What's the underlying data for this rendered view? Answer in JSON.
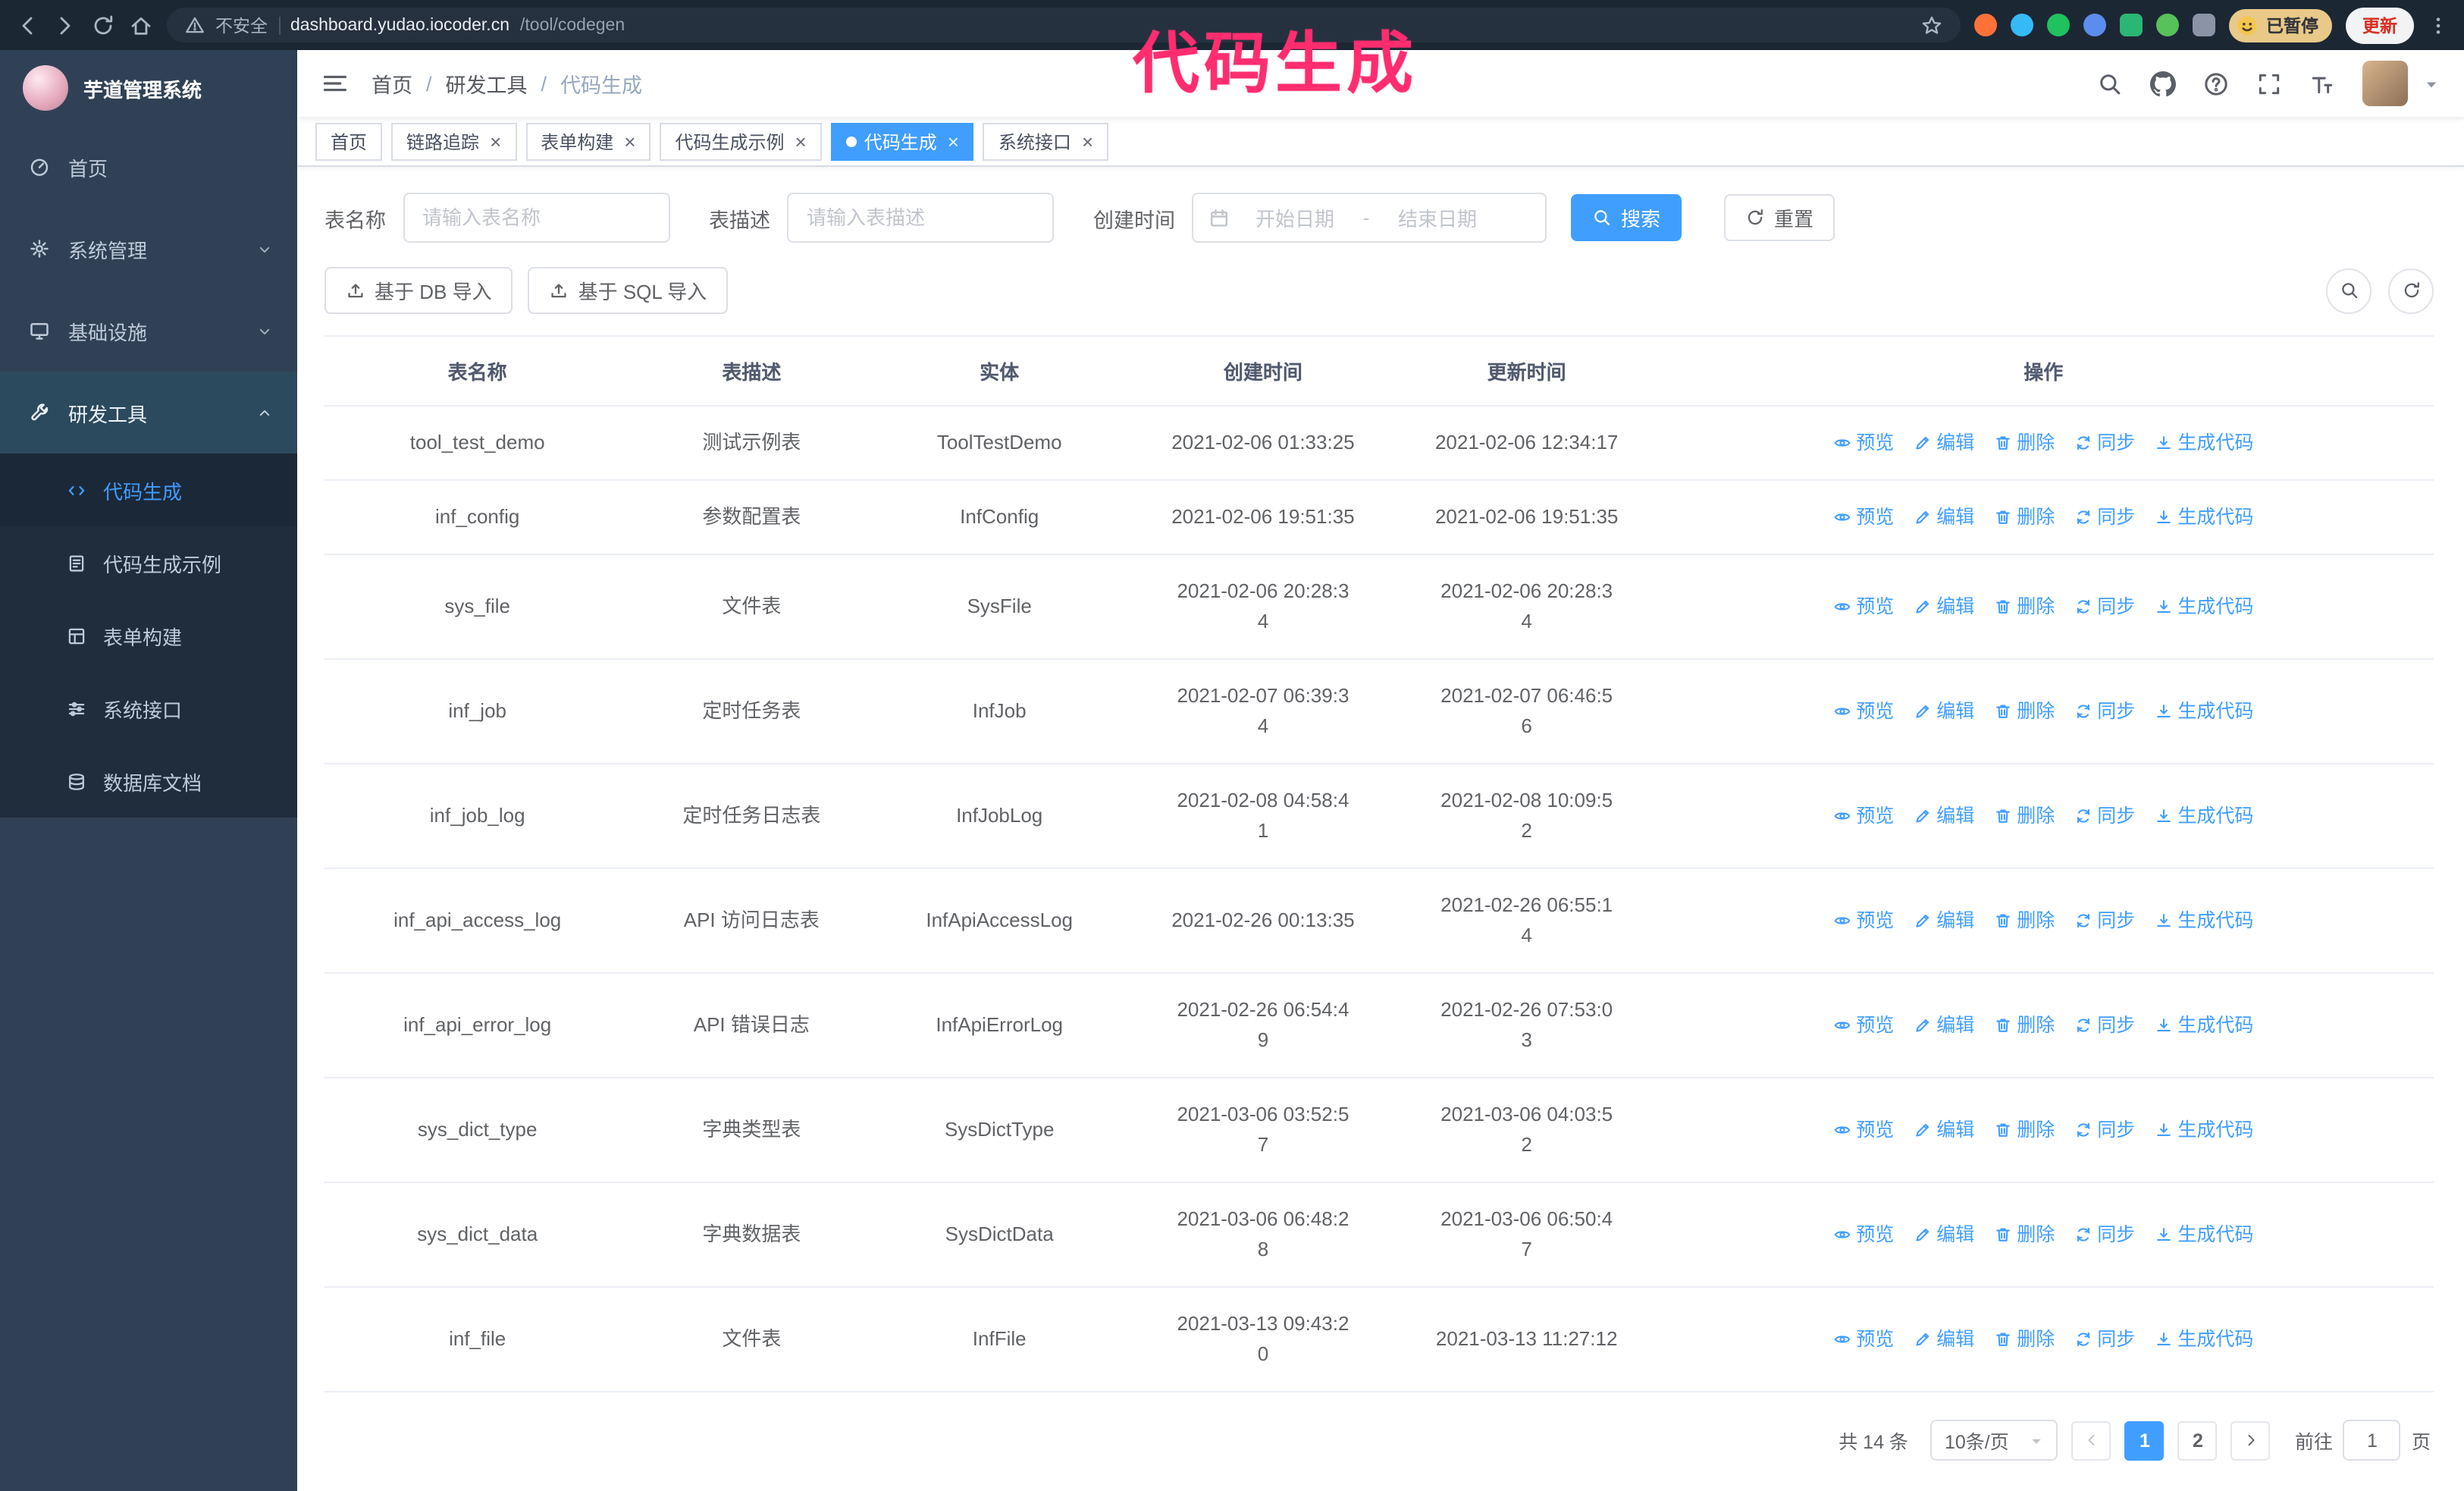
{
  "theme": {
    "accent": "#409eff",
    "sidebar_bg": "#304156",
    "submenu_bg": "#1f2d3d",
    "annotation_color": "#ff2d6f"
  },
  "browser": {
    "security_label": "不安全",
    "url_domain": "dashboard.yudao.iocoder.cn",
    "url_path": "/tool/codegen",
    "paused_badge_label": "已暂停",
    "update_button_label": "更新",
    "extensions": [
      {
        "name": "fox-extension-icon",
        "color": "#ff7139",
        "shape": "circle"
      },
      {
        "name": "drop-extension-icon",
        "color": "#35baf6",
        "shape": "circle"
      },
      {
        "name": "v-green-extension-icon",
        "color": "#1fc25e",
        "shape": "circle"
      },
      {
        "name": "people-extension-icon",
        "color": "#5b8def",
        "shape": "circle"
      },
      {
        "name": "card-extension-icon",
        "color": "#2bb673",
        "shape": "square"
      },
      {
        "name": "leaf-extension-icon",
        "color": "#57c15a",
        "shape": "circle"
      },
      {
        "name": "puzzle-extension-icon",
        "color": "#8a94a6",
        "shape": "square"
      }
    ]
  },
  "annotation": {
    "text": "代码生成"
  },
  "sidebar": {
    "logo_title": "芋道管理系统",
    "items": [
      {
        "id": "home",
        "label": "首页",
        "icon": "dashboard-icon"
      },
      {
        "id": "system",
        "label": "系统管理",
        "icon": "gear-icon",
        "chevron": "down"
      },
      {
        "id": "infra",
        "label": "基础设施",
        "icon": "monitor-icon",
        "chevron": "down"
      },
      {
        "id": "devtools",
        "label": "研发工具",
        "icon": "wrench-icon",
        "chevron": "up",
        "active_parent": true,
        "children": [
          {
            "id": "codegen",
            "label": "代码生成",
            "icon": "code-icon",
            "active": true
          },
          {
            "id": "codegen-example",
            "label": "代码生成示例",
            "icon": "example-icon"
          },
          {
            "id": "form-build",
            "label": "表单构建",
            "icon": "form-icon"
          },
          {
            "id": "system-api",
            "label": "系统接口",
            "icon": "api-icon"
          },
          {
            "id": "db-doc",
            "label": "数据库文档",
            "icon": "database-icon"
          }
        ]
      }
    ]
  },
  "navbar": {
    "breadcrumb": [
      "首页",
      "研发工具",
      "代码生成"
    ],
    "icons": [
      "search-icon",
      "github-icon",
      "question-icon",
      "fullscreen-icon",
      "fontsize-icon"
    ]
  },
  "tabs": [
    {
      "id": "home",
      "label": "首页",
      "closable": false
    },
    {
      "id": "tracer",
      "label": "链路追踪",
      "closable": true
    },
    {
      "id": "form-build",
      "label": "表单构建",
      "closable": true
    },
    {
      "id": "codegen-example",
      "label": "代码生成示例",
      "closable": true
    },
    {
      "id": "codegen",
      "label": "代码生成",
      "closable": true,
      "active": true
    },
    {
      "id": "system-api",
      "label": "系统接口",
      "closable": true
    }
  ],
  "search_form": {
    "table_name_label": "表名称",
    "table_name_placeholder": "请输入表名称",
    "table_desc_label": "表描述",
    "table_desc_placeholder": "请输入表描述",
    "create_time_label": "创建时间",
    "date_start_placeholder": "开始日期",
    "date_separator": "-",
    "date_end_placeholder": "结束日期",
    "search_button": "搜索",
    "reset_button": "重置"
  },
  "toolbar": {
    "import_db_button": "基于 DB 导入",
    "import_sql_button": "基于 SQL 导入"
  },
  "table": {
    "columns": [
      "表名称",
      "表描述",
      "实体",
      "创建时间",
      "更新时间",
      "操作"
    ],
    "actions": [
      {
        "id": "preview",
        "label": "预览",
        "icon": "eye-icon"
      },
      {
        "id": "edit",
        "label": "编辑",
        "icon": "edit-icon"
      },
      {
        "id": "delete",
        "label": "删除",
        "icon": "trash-icon"
      },
      {
        "id": "sync",
        "label": "同步",
        "icon": "sync-icon"
      },
      {
        "id": "generate-code",
        "label": "生成代码",
        "icon": "download-icon"
      }
    ],
    "rows": [
      {
        "name": "tool_test_demo",
        "desc": "测试示例表",
        "entity": "ToolTestDemo",
        "create_time": "2021-02-06 01:33:25",
        "update_time": "2021-02-06 12:34:17"
      },
      {
        "name": "inf_config",
        "desc": "参数配置表",
        "entity": "InfConfig",
        "create_time": "2021-02-06 19:51:35",
        "update_time": "2021-02-06 19:51:35"
      },
      {
        "name": "sys_file",
        "desc": "文件表",
        "entity": "SysFile",
        "create_time": "2021-02-06 20:28:3\n4",
        "update_time": "2021-02-06 20:28:3\n4"
      },
      {
        "name": "inf_job",
        "desc": "定时任务表",
        "entity": "InfJob",
        "create_time": "2021-02-07 06:39:3\n4",
        "update_time": "2021-02-07 06:46:5\n6"
      },
      {
        "name": "inf_job_log",
        "desc": "定时任务日志表",
        "entity": "InfJobLog",
        "create_time": "2021-02-08 04:58:4\n1",
        "update_time": "2021-02-08 10:09:5\n2"
      },
      {
        "name": "inf_api_access_log",
        "desc": "API 访问日志表",
        "entity": "InfApiAccessLog",
        "create_time": "2021-02-26 00:13:35",
        "update_time": "2021-02-26 06:55:1\n4"
      },
      {
        "name": "inf_api_error_log",
        "desc": "API 错误日志",
        "entity": "InfApiErrorLog",
        "create_time": "2021-02-26 06:54:4\n9",
        "update_time": "2021-02-26 07:53:0\n3"
      },
      {
        "name": "sys_dict_type",
        "desc": "字典类型表",
        "entity": "SysDictType",
        "create_time": "2021-03-06 03:52:5\n7",
        "update_time": "2021-03-06 04:03:5\n2"
      },
      {
        "name": "sys_dict_data",
        "desc": "字典数据表",
        "entity": "SysDictData",
        "create_time": "2021-03-06 06:48:2\n8",
        "update_time": "2021-03-06 06:50:4\n7"
      },
      {
        "name": "inf_file",
        "desc": "文件表",
        "entity": "InfFile",
        "create_time": "2021-03-13 09:43:2\n0",
        "update_time": "2021-03-13 11:27:12"
      }
    ]
  },
  "pagination": {
    "total_text": "共 14 条",
    "page_size_value": "10条/页",
    "pages": [
      "1",
      "2"
    ],
    "active_page": "1",
    "goto_label": "前往",
    "goto_value": "1",
    "goto_suffix": "页"
  }
}
